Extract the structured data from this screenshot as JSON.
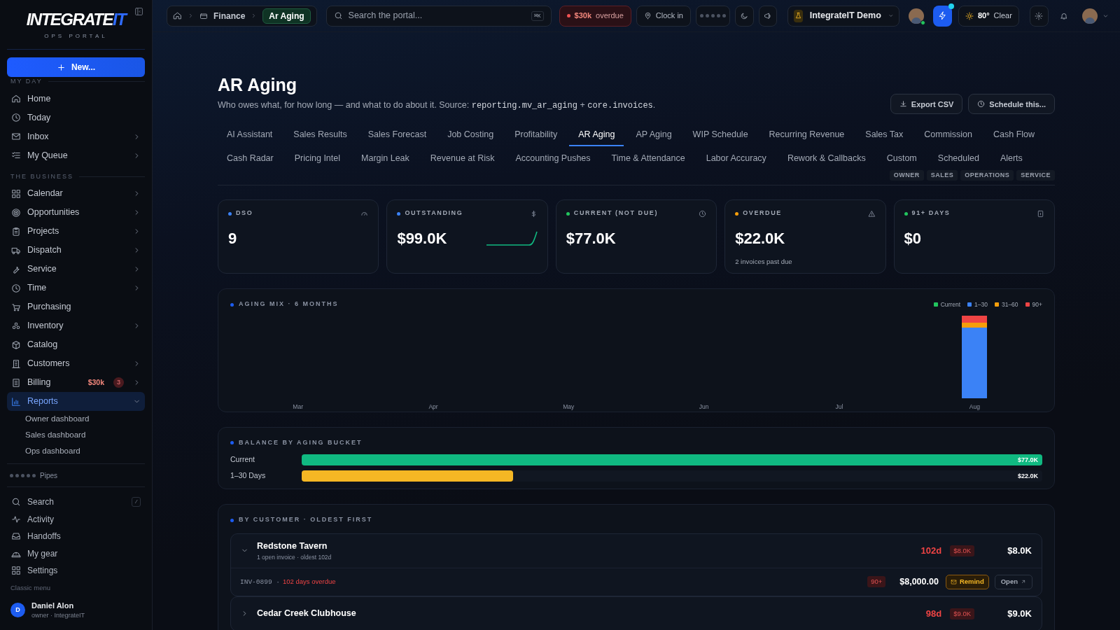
{
  "sidebar": {
    "logo": {
      "main": "INTEGRATE",
      "accent": "IT",
      "subtitle": "OPS PORTAL"
    },
    "new_button": "New...",
    "sections": [
      {
        "heading": "MY DAY",
        "items": [
          {
            "label": "Home",
            "expandable": false,
            "selected": false
          },
          {
            "label": "Today",
            "expandable": false,
            "selected": false
          },
          {
            "label": "Inbox",
            "expandable": true,
            "selected": false
          },
          {
            "label": "My Queue",
            "expandable": true,
            "selected": false
          }
        ]
      },
      {
        "heading": "THE BUSINESS",
        "items": [
          {
            "label": "Calendar",
            "expandable": true,
            "selected": false
          },
          {
            "label": "Opportunities",
            "expandable": true,
            "selected": false
          },
          {
            "label": "Projects",
            "expandable": true,
            "selected": false
          },
          {
            "label": "Dispatch",
            "expandable": true,
            "selected": false
          },
          {
            "label": "Service",
            "expandable": true,
            "selected": false
          },
          {
            "label": "Time",
            "expandable": true,
            "selected": false
          },
          {
            "label": "Purchasing",
            "expandable": false,
            "selected": false
          },
          {
            "label": "Inventory",
            "expandable": true,
            "selected": false
          },
          {
            "label": "Catalog",
            "expandable": false,
            "selected": false
          },
          {
            "label": "Customers",
            "expandable": true,
            "selected": false
          },
          {
            "label": "Billing",
            "expandable": true,
            "selected": false,
            "amount": "$30k",
            "count": "3"
          },
          {
            "label": "Reports",
            "expandable": true,
            "selected": true,
            "expanded": true,
            "children": [
              {
                "label": "Owner dashboard"
              },
              {
                "label": "Sales dashboard"
              },
              {
                "label": "Ops dashboard"
              }
            ]
          }
        ]
      }
    ],
    "pipes": "Pipes",
    "footer_items": [
      {
        "label": "Search",
        "shortcut": "/"
      },
      {
        "label": "Activity"
      },
      {
        "label": "Handoffs"
      },
      {
        "label": "My gear"
      },
      {
        "label": "Settings"
      }
    ],
    "classic_menu": "Classic menu",
    "user": {
      "initial": "D",
      "name": "Daniel Alon",
      "role": "owner · IntegrateIT"
    }
  },
  "topbar": {
    "breadcrumb": [
      {
        "label": "Finance",
        "selected": false
      },
      {
        "label": "Ar Aging",
        "selected": true
      }
    ],
    "search": {
      "placeholder": "Search the portal...",
      "shortcut": "⌘K"
    },
    "overdue": {
      "amount": "$30k",
      "label": "overdue"
    },
    "clock_in": "Clock in",
    "org": "IntegrateIT Demo",
    "weather": {
      "temp": "80°",
      "label": "Clear"
    }
  },
  "page": {
    "title": "AR Aging",
    "subtitle": [
      {
        "kind": "text",
        "text": "Who owes what, for how long — and what to do about it. Source: "
      },
      {
        "kind": "code",
        "text": "reporting.mv_ar_aging"
      },
      {
        "kind": "text",
        "text": " + "
      },
      {
        "kind": "code",
        "text": "core.invoices"
      },
      {
        "kind": "text",
        "text": "."
      }
    ],
    "actions": [
      "Export CSV",
      "Schedule this..."
    ],
    "tab_rows": [
      [
        {
          "label": "AI Assistant",
          "selected": false
        },
        {
          "label": "Sales Results",
          "selected": false
        },
        {
          "label": "Sales Forecast",
          "selected": false
        },
        {
          "label": "Job Costing",
          "selected": false
        },
        {
          "label": "Profitability",
          "selected": false
        },
        {
          "label": "AR Aging",
          "selected": true
        },
        {
          "label": "AP Aging",
          "selected": false
        },
        {
          "label": "WIP Schedule",
          "selected": false
        },
        {
          "label": "Recurring Revenue",
          "selected": false
        },
        {
          "label": "Sales Tax",
          "selected": false
        },
        {
          "label": "Commission",
          "selected": false
        },
        {
          "label": "Cash Flow",
          "selected": false
        }
      ],
      [
        {
          "label": "Cash Radar",
          "selected": false
        },
        {
          "label": "Pricing Intel",
          "selected": false
        },
        {
          "label": "Margin Leak",
          "selected": false
        },
        {
          "label": "Revenue at Risk",
          "selected": false
        },
        {
          "label": "Accounting Pushes",
          "selected": false
        },
        {
          "label": "Time & Attendance",
          "selected": false
        },
        {
          "label": "Labor Accuracy",
          "selected": false
        },
        {
          "label": "Rework & Callbacks",
          "selected": false
        },
        {
          "label": "Custom",
          "selected": false
        },
        {
          "label": "Scheduled",
          "selected": false
        },
        {
          "label": "Alerts",
          "selected": false
        }
      ]
    ],
    "roles": [
      "OWNER",
      "SALES",
      "OPERATIONS",
      "SERVICE"
    ]
  },
  "kpis": [
    {
      "label": "DSO",
      "color": "#3b82f6",
      "value": "9",
      "sparkline": false
    },
    {
      "label": "OUTSTANDING",
      "color": "#3b82f6",
      "value": "$99.0K",
      "sparkline": true
    },
    {
      "label": "CURRENT (NOT DUE)",
      "color": "#22c55e",
      "value": "$77.0K",
      "sparkline": false
    },
    {
      "label": "OVERDUE",
      "color": "#f59e0b",
      "value": "$22.0K",
      "note": "2 invoices past due",
      "sparkline": false
    },
    {
      "label": "91+ DAYS",
      "color": "#22c55e",
      "value": "$0",
      "sparkline": false
    }
  ],
  "aging_mix": {
    "title": "AGING MIX · 6 MONTHS",
    "legend": [
      {
        "label": "Current",
        "color": "#22c55e"
      },
      {
        "label": "1–30",
        "color": "#3b82f6"
      },
      {
        "label": "31–60",
        "color": "#f59e0b"
      },
      {
        "label": "90+",
        "color": "#ef4444"
      }
    ],
    "months": [
      "Mar",
      "Apr",
      "May",
      "Jun",
      "Jul",
      "Aug"
    ]
  },
  "balance": {
    "title": "BALANCE BY AGING BUCKET",
    "rows": [
      {
        "label": "Current",
        "value": "$77.0K",
        "level": 1,
        "color": "#10b981"
      },
      {
        "label": "1–30 Days",
        "value": "$22.0K",
        "level": 0.285,
        "color": "#f5b724"
      }
    ]
  },
  "customers": {
    "title": "BY CUSTOMER · OLDEST FIRST",
    "items": [
      {
        "name": "Redstone Tavern",
        "sub": "1 open invoice · oldest 102d",
        "age": "102d",
        "badge": "$8.0K",
        "total": "$8.0K",
        "expanded": true,
        "invoices": [
          {
            "id": "INV-0899 ·",
            "status": "102 days overdue",
            "bucket": "90+",
            "amount": "$8,000.00",
            "remind": "Remind",
            "open": "Open"
          }
        ]
      },
      {
        "name": "Cedar Creek Clubhouse",
        "age": "98d",
        "badge": "$9.0K",
        "total": "$9.0K",
        "expanded": false
      }
    ]
  }
}
